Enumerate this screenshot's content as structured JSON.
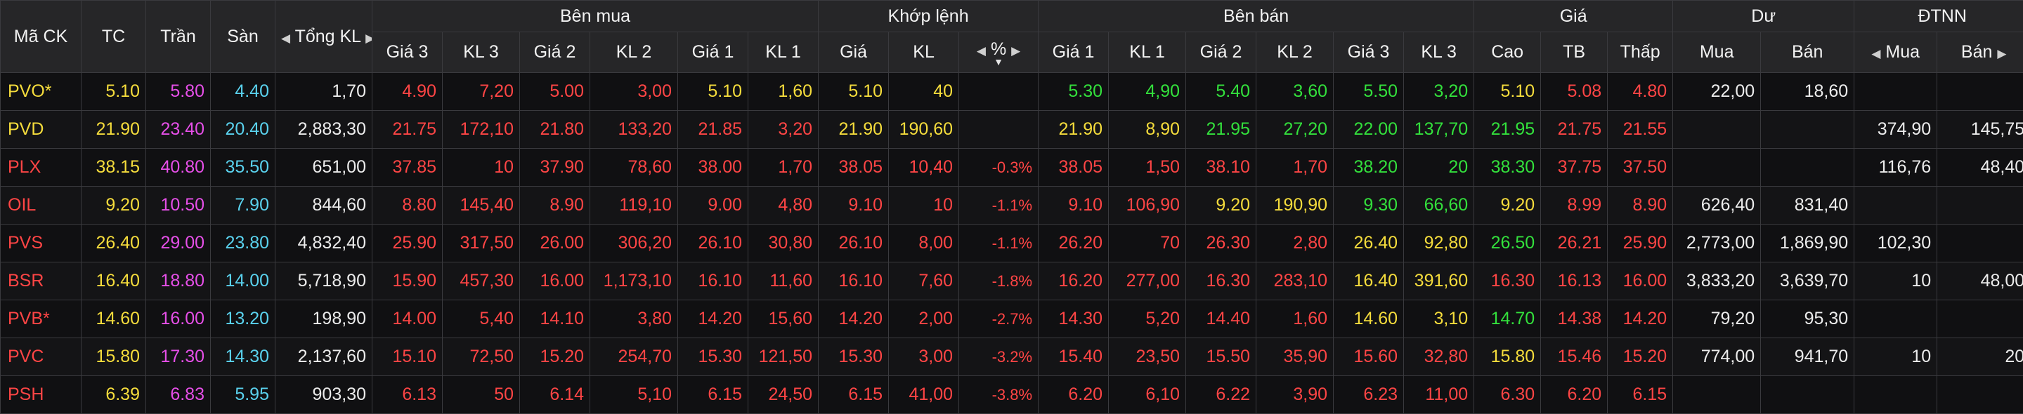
{
  "colors": {
    "ref": "#f5dc3c",
    "ceil": "#e64fe8",
    "floor": "#5ad2ee",
    "up": "#33e03c",
    "down": "#ff4545",
    "white": "#ececec",
    "background": "#101012",
    "header_bg": "#262628"
  },
  "header": {
    "symbol": "Mã CK",
    "ref": "TC",
    "ceil": "Trần",
    "floor": "Sàn",
    "total_vol": "Tổng KL",
    "buy_group": "Bên mua",
    "match_group": "Khớp lệnh",
    "sell_group": "Bên bán",
    "price_group": "Giá",
    "remain_group": "Dư",
    "foreign_group": "ĐTNN",
    "bid_price3": "Giá 3",
    "bid_vol3": "KL 3",
    "bid_price2": "Giá 2",
    "bid_vol2": "KL 2",
    "bid_price1": "Giá 1",
    "bid_vol1": "KL 1",
    "match_price": "Giá",
    "match_vol": "KL",
    "match_pct": "%",
    "ask_price1": "Giá 1",
    "ask_vol1": "KL 1",
    "ask_price2": "Giá 2",
    "ask_vol2": "KL 2",
    "ask_price3": "Giá 3",
    "ask_vol3": "KL 3",
    "high": "Cao",
    "avg": "TB",
    "low": "Thấp",
    "remain_buy": "Mua",
    "remain_sell": "Bán",
    "foreign_buy": "Mua",
    "foreign_sell": "Bán",
    "arrow_left": "◀",
    "arrow_right": "▶",
    "sort_mark": "▼"
  },
  "rows": [
    {
      "sym": "PVO*",
      "symc": "ref",
      "ref": "5.10",
      "ceil": "5.80",
      "floor": "4.40",
      "total": "1,70",
      "b3p": "4.90",
      "b3pc": "down",
      "b3v": "7,20",
      "b3vc": "down",
      "b2p": "5.00",
      "b2pc": "down",
      "b2v": "3,00",
      "b2vc": "down",
      "b1p": "5.10",
      "b1pc": "ref",
      "b1v": "1,60",
      "b1vc": "ref",
      "mp": "5.10",
      "mpc": "ref",
      "mv": "40",
      "mvc": "ref",
      "pct": "",
      "pctc": "ref",
      "a1p": "5.30",
      "a1pc": "up",
      "a1v": "4,90",
      "a1vc": "up",
      "a2p": "5.40",
      "a2pc": "up",
      "a2v": "3,60",
      "a2vc": "up",
      "a3p": "5.50",
      "a3pc": "up",
      "a3v": "3,20",
      "a3vc": "up",
      "hi": "5.10",
      "hic": "ref",
      "avg": "5.08",
      "avgc": "down",
      "lo": "4.80",
      "loc": "down",
      "rb": "22,00",
      "rs": "18,60",
      "fb": "",
      "fs": ""
    },
    {
      "sym": "PVD",
      "symc": "ref",
      "ref": "21.90",
      "ceil": "23.40",
      "floor": "20.40",
      "total": "2,883,30",
      "b3p": "21.75",
      "b3pc": "down",
      "b3v": "172,10",
      "b3vc": "down",
      "b2p": "21.80",
      "b2pc": "down",
      "b2v": "133,20",
      "b2vc": "down",
      "b1p": "21.85",
      "b1pc": "down",
      "b1v": "3,20",
      "b1vc": "down",
      "mp": "21.90",
      "mpc": "ref",
      "mv": "190,60",
      "mvc": "ref",
      "pct": "",
      "pctc": "ref",
      "a1p": "21.90",
      "a1pc": "ref",
      "a1v": "8,90",
      "a1vc": "ref",
      "a2p": "21.95",
      "a2pc": "up",
      "a2v": "27,20",
      "a2vc": "up",
      "a3p": "22.00",
      "a3pc": "up",
      "a3v": "137,70",
      "a3vc": "up",
      "hi": "21.95",
      "hic": "up",
      "avg": "21.75",
      "avgc": "down",
      "lo": "21.55",
      "loc": "down",
      "rb": "",
      "rs": "",
      "fb": "374,90",
      "fs": "145,75"
    },
    {
      "sym": "PLX",
      "symc": "down",
      "ref": "38.15",
      "ceil": "40.80",
      "floor": "35.50",
      "total": "651,00",
      "b3p": "37.85",
      "b3pc": "down",
      "b3v": "10",
      "b3vc": "down",
      "b2p": "37.90",
      "b2pc": "down",
      "b2v": "78,60",
      "b2vc": "down",
      "b1p": "38.00",
      "b1pc": "down",
      "b1v": "1,70",
      "b1vc": "down",
      "mp": "38.05",
      "mpc": "down",
      "mv": "10,40",
      "mvc": "down",
      "pct": "-0.3%",
      "pctc": "down",
      "a1p": "38.05",
      "a1pc": "down",
      "a1v": "1,50",
      "a1vc": "down",
      "a2p": "38.10",
      "a2pc": "down",
      "a2v": "1,70",
      "a2vc": "down",
      "a3p": "38.20",
      "a3pc": "up",
      "a3v": "20",
      "a3vc": "up",
      "hi": "38.30",
      "hic": "up",
      "avg": "37.75",
      "avgc": "down",
      "lo": "37.50",
      "loc": "down",
      "rb": "",
      "rs": "",
      "fb": "116,76",
      "fs": "48,40"
    },
    {
      "sym": "OIL",
      "symc": "down",
      "ref": "9.20",
      "ceil": "10.50",
      "floor": "7.90",
      "total": "844,60",
      "b3p": "8.80",
      "b3pc": "down",
      "b3v": "145,40",
      "b3vc": "down",
      "b2p": "8.90",
      "b2pc": "down",
      "b2v": "119,10",
      "b2vc": "down",
      "b1p": "9.00",
      "b1pc": "down",
      "b1v": "4,80",
      "b1vc": "down",
      "mp": "9.10",
      "mpc": "down",
      "mv": "10",
      "mvc": "down",
      "pct": "-1.1%",
      "pctc": "down",
      "a1p": "9.10",
      "a1pc": "down",
      "a1v": "106,90",
      "a1vc": "down",
      "a2p": "9.20",
      "a2pc": "ref",
      "a2v": "190,90",
      "a2vc": "ref",
      "a3p": "9.30",
      "a3pc": "up",
      "a3v": "66,60",
      "a3vc": "up",
      "hi": "9.20",
      "hic": "ref",
      "avg": "8.99",
      "avgc": "down",
      "lo": "8.90",
      "loc": "down",
      "rb": "626,40",
      "rs": "831,40",
      "fb": "",
      "fs": ""
    },
    {
      "sym": "PVS",
      "symc": "down",
      "ref": "26.40",
      "ceil": "29.00",
      "floor": "23.80",
      "total": "4,832,40",
      "b3p": "25.90",
      "b3pc": "down",
      "b3v": "317,50",
      "b3vc": "down",
      "b2p": "26.00",
      "b2pc": "down",
      "b2v": "306,20",
      "b2vc": "down",
      "b1p": "26.10",
      "b1pc": "down",
      "b1v": "30,80",
      "b1vc": "down",
      "mp": "26.10",
      "mpc": "down",
      "mv": "8,00",
      "mvc": "down",
      "pct": "-1.1%",
      "pctc": "down",
      "a1p": "26.20",
      "a1pc": "down",
      "a1v": "70",
      "a1vc": "down",
      "a2p": "26.30",
      "a2pc": "down",
      "a2v": "2,80",
      "a2vc": "down",
      "a3p": "26.40",
      "a3pc": "ref",
      "a3v": "92,80",
      "a3vc": "ref",
      "hi": "26.50",
      "hic": "up",
      "avg": "26.21",
      "avgc": "down",
      "lo": "25.90",
      "loc": "down",
      "rb": "2,773,00",
      "rs": "1,869,90",
      "fb": "102,30",
      "fs": ""
    },
    {
      "sym": "BSR",
      "symc": "down",
      "ref": "16.40",
      "ceil": "18.80",
      "floor": "14.00",
      "total": "5,718,90",
      "b3p": "15.90",
      "b3pc": "down",
      "b3v": "457,30",
      "b3vc": "down",
      "b2p": "16.00",
      "b2pc": "down",
      "b2v": "1,173,10",
      "b2vc": "down",
      "b1p": "16.10",
      "b1pc": "down",
      "b1v": "11,60",
      "b1vc": "down",
      "mp": "16.10",
      "mpc": "down",
      "mv": "7,60",
      "mvc": "down",
      "pct": "-1.8%",
      "pctc": "down",
      "a1p": "16.20",
      "a1pc": "down",
      "a1v": "277,00",
      "a1vc": "down",
      "a2p": "16.30",
      "a2pc": "down",
      "a2v": "283,10",
      "a2vc": "down",
      "a3p": "16.40",
      "a3pc": "ref",
      "a3v": "391,60",
      "a3vc": "ref",
      "hi": "16.30",
      "hic": "down",
      "avg": "16.13",
      "avgc": "down",
      "lo": "16.00",
      "loc": "down",
      "rb": "3,833,20",
      "rs": "3,639,70",
      "fb": "10",
      "fs": "48,00"
    },
    {
      "sym": "PVB*",
      "symc": "down",
      "ref": "14.60",
      "ceil": "16.00",
      "floor": "13.20",
      "total": "198,90",
      "b3p": "14.00",
      "b3pc": "down",
      "b3v": "5,40",
      "b3vc": "down",
      "b2p": "14.10",
      "b2pc": "down",
      "b2v": "3,80",
      "b2vc": "down",
      "b1p": "14.20",
      "b1pc": "down",
      "b1v": "15,60",
      "b1vc": "down",
      "mp": "14.20",
      "mpc": "down",
      "mv": "2,00",
      "mvc": "down",
      "pct": "-2.7%",
      "pctc": "down",
      "a1p": "14.30",
      "a1pc": "down",
      "a1v": "5,20",
      "a1vc": "down",
      "a2p": "14.40",
      "a2pc": "down",
      "a2v": "1,60",
      "a2vc": "down",
      "a3p": "14.60",
      "a3pc": "ref",
      "a3v": "3,10",
      "a3vc": "ref",
      "hi": "14.70",
      "hic": "up",
      "avg": "14.38",
      "avgc": "down",
      "lo": "14.20",
      "loc": "down",
      "rb": "79,20",
      "rs": "95,30",
      "fb": "",
      "fs": ""
    },
    {
      "sym": "PVC",
      "symc": "down",
      "ref": "15.80",
      "ceil": "17.30",
      "floor": "14.30",
      "total": "2,137,60",
      "b3p": "15.10",
      "b3pc": "down",
      "b3v": "72,50",
      "b3vc": "down",
      "b2p": "15.20",
      "b2pc": "down",
      "b2v": "254,70",
      "b2vc": "down",
      "b1p": "15.30",
      "b1pc": "down",
      "b1v": "121,50",
      "b1vc": "down",
      "mp": "15.30",
      "mpc": "down",
      "mv": "3,00",
      "mvc": "down",
      "pct": "-3.2%",
      "pctc": "down",
      "a1p": "15.40",
      "a1pc": "down",
      "a1v": "23,50",
      "a1vc": "down",
      "a2p": "15.50",
      "a2pc": "down",
      "a2v": "35,90",
      "a2vc": "down",
      "a3p": "15.60",
      "a3pc": "down",
      "a3v": "32,80",
      "a3vc": "down",
      "hi": "15.80",
      "hic": "ref",
      "avg": "15.46",
      "avgc": "down",
      "lo": "15.20",
      "loc": "down",
      "rb": "774,00",
      "rs": "941,70",
      "fb": "10",
      "fs": "20"
    },
    {
      "sym": "PSH",
      "symc": "down",
      "ref": "6.39",
      "ceil": "6.83",
      "floor": "5.95",
      "total": "903,30",
      "b3p": "6.13",
      "b3pc": "down",
      "b3v": "50",
      "b3vc": "down",
      "b2p": "6.14",
      "b2pc": "down",
      "b2v": "5,10",
      "b2vc": "down",
      "b1p": "6.15",
      "b1pc": "down",
      "b1v": "24,50",
      "b1vc": "down",
      "mp": "6.15",
      "mpc": "down",
      "mv": "41,00",
      "mvc": "down",
      "pct": "-3.8%",
      "pctc": "down",
      "a1p": "6.20",
      "a1pc": "down",
      "a1v": "6,10",
      "a1vc": "down",
      "a2p": "6.22",
      "a2pc": "down",
      "a2v": "3,90",
      "a2vc": "down",
      "a3p": "6.23",
      "a3pc": "down",
      "a3v": "11,00",
      "a3vc": "down",
      "hi": "6.30",
      "hic": "down",
      "avg": "6.20",
      "avgc": "down",
      "lo": "6.15",
      "loc": "down",
      "rb": "",
      "rs": "",
      "fb": "",
      "fs": ""
    }
  ]
}
